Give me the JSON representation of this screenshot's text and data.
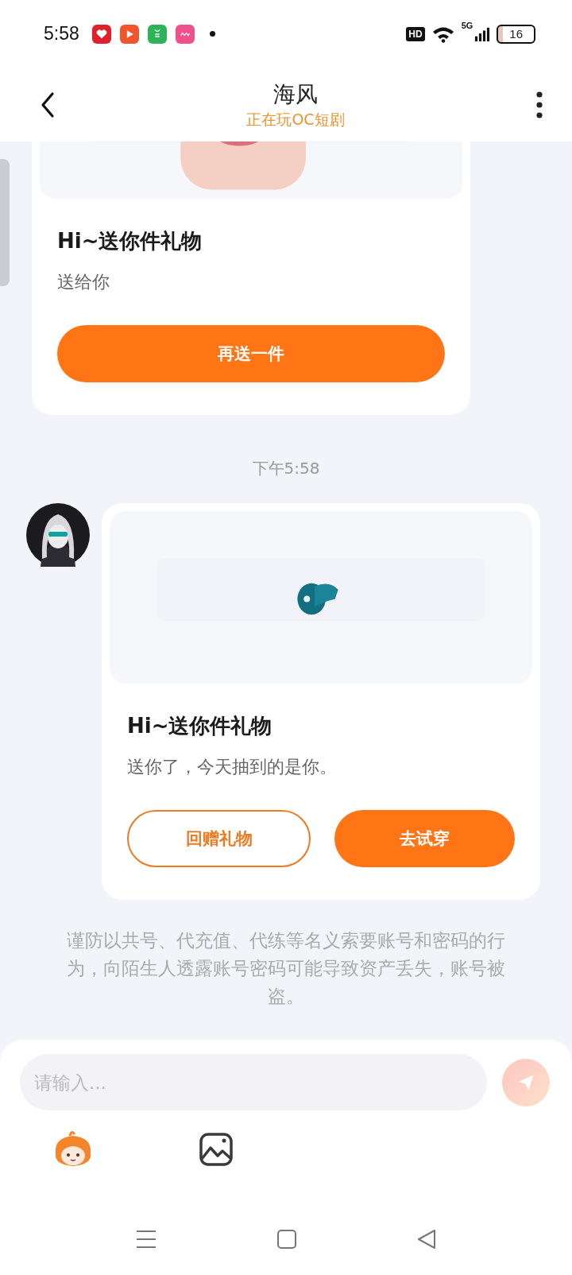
{
  "status_bar": {
    "time": "5:58",
    "hd": "HD",
    "network": "5G",
    "battery": "16"
  },
  "header": {
    "title": "海风",
    "subtitle": "正在玩OC短剧"
  },
  "messages": [
    {
      "kind": "gift_card",
      "avatar": false,
      "title": "Hi~送你件礼物",
      "text": "送给你",
      "buttons": [
        {
          "label": "再送一件",
          "kind": "primary"
        }
      ]
    },
    {
      "kind": "timestamp",
      "text": "下午5:58"
    },
    {
      "kind": "gift_card",
      "avatar": true,
      "title": "Hi~送你件礼物",
      "text": "送你了，今天抽到的是你。",
      "buttons": [
        {
          "label": "回赠礼物",
          "kind": "outline"
        },
        {
          "label": "去试穿",
          "kind": "primary"
        }
      ]
    }
  ],
  "notice": "谨防以共号、代充值、代练等名义索要账号和密码的行为，向陌生人透露账号密码可能导致资产丢失，账号被盗。",
  "composer": {
    "placeholder": "请输入..."
  }
}
